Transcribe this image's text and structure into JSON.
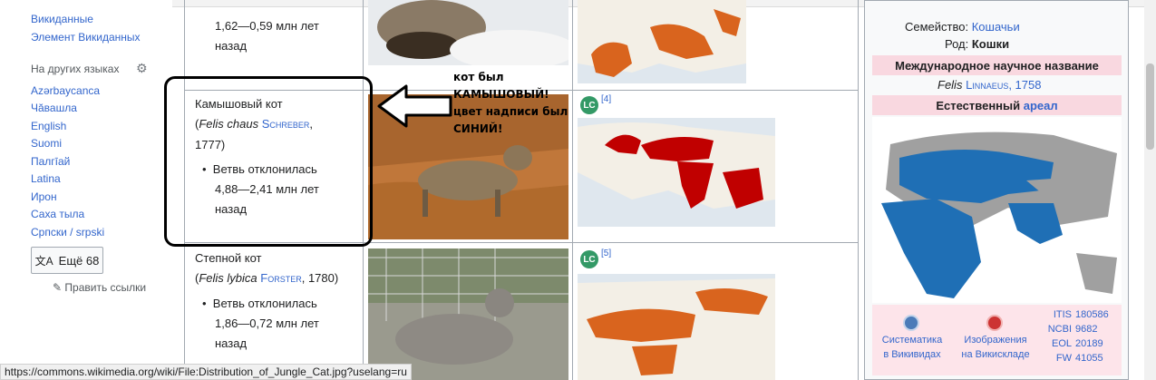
{
  "sidebar": {
    "top_links": [
      "Викиданные",
      "Элемент Викиданных"
    ],
    "languages_heading": "На других языках",
    "languages": [
      "Azərbaycanca",
      "Чăвашла",
      "English",
      "Suomi",
      "Пaлгīай",
      "Latina",
      "Ирон",
      "Саха тыла",
      "Српски / srpski"
    ],
    "more_button": "Ещё 68",
    "edit_links": "Править ссылки"
  },
  "rows": [
    {
      "range": [
        "1,62—0,59 млн лет",
        "назад"
      ]
    },
    {
      "name": "Камышовый кот",
      "latin_open": "(",
      "latin_genus": "Felis chaus",
      "author": "Schreber",
      "year_suffix": ",",
      "year": "1777)",
      "bullet": "Ветвь отклонилась",
      "range": [
        "4,88—2,41 млн лет",
        "назад"
      ],
      "ref": "[4]",
      "badge": "LC"
    },
    {
      "name": "Степной кот",
      "latin_open": "(",
      "latin_genus": "Felis lybica",
      "author": "Forster",
      "year": ", 1780)",
      "bullet": "Ветвь отклонилась",
      "range": [
        "1,86—0,72 млн лет",
        "назад"
      ],
      "ref": "[5]",
      "badge": "LC"
    }
  ],
  "annotation": {
    "lines": [
      "кот был",
      "КАМЫШОВЫЙ!",
      "цвет надписи был",
      "СИНИЙ!"
    ]
  },
  "infobox": {
    "family_label": "Семейство:",
    "family_value": "Кошачьи",
    "genus_label": "Род:",
    "genus_value": "Кошки",
    "intl_name_heading": "Международное научное название",
    "intl_name_genus": "Felis",
    "intl_name_author": "Linnaeus",
    "intl_name_year": ", 1758",
    "range_heading_prefix": "Естественный",
    "range_heading_link": "ареал",
    "proj1": [
      "Систематика",
      "в Викивидах"
    ],
    "proj2": [
      "Изображения",
      "на Викискладе"
    ],
    "ids": [
      {
        "k": "ITIS",
        "v": "180586"
      },
      {
        "k": "NCBI",
        "v": "9682"
      },
      {
        "k": "EOL",
        "v": "20189"
      },
      {
        "k": "FW",
        "v": "41055"
      }
    ]
  },
  "status_url": "https://commons.wikimedia.org/wiki/File:Distribution_of_Jungle_Cat.jpg?uselang=ru",
  "colors": {
    "link": "#3366cc",
    "visited": "#795cb2",
    "map_range_orange": "#d9641e",
    "map_range_red": "#c00000",
    "infobox_head": "#f9d8e0",
    "lc_green": "#339966"
  }
}
